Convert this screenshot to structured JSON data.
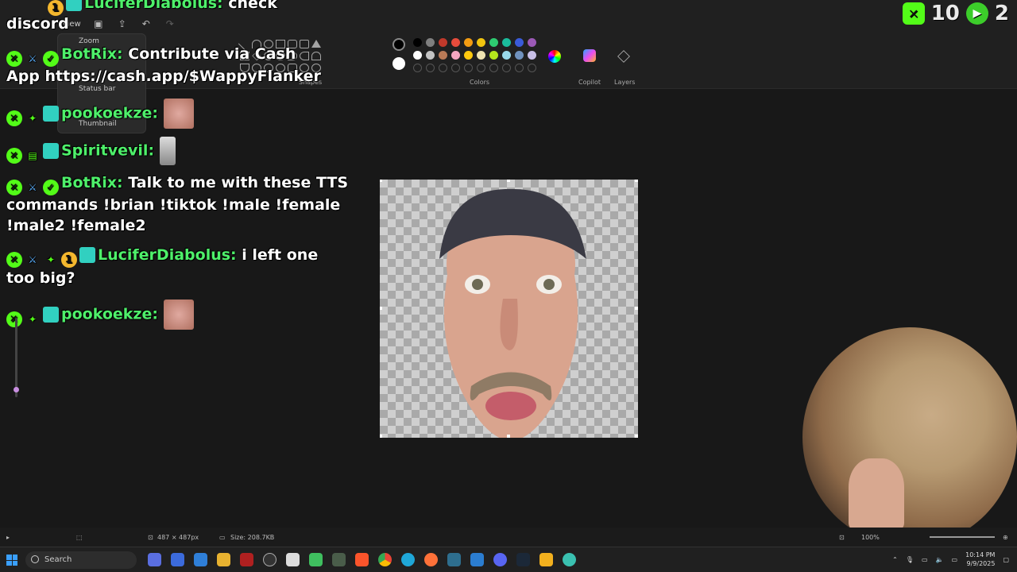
{
  "ribbon": {
    "view_menu": "View",
    "groups": [
      "Shapes",
      "Colors",
      "Copilot",
      "Layers"
    ],
    "dropdown_items": [
      "Zoom",
      "Status bar",
      "Thumbnail"
    ],
    "palette": {
      "big": [
        "#000000",
        "#ffffff"
      ],
      "row1": [
        "#000000",
        "#7f7f7f",
        "#c0392b",
        "#e74c3c",
        "#f39c12",
        "#f1c40f",
        "#2ecc71",
        "#1abc9c",
        "#3a5bd9",
        "#9b59b6"
      ],
      "row2": [
        "#ffffff",
        "#c3c3c3",
        "#b97a57",
        "#f4a6c0",
        "#ffc90e",
        "#efe4b0",
        "#b5e61d",
        "#99d9ea",
        "#7092be",
        "#c8bfe7"
      ]
    }
  },
  "chat": [
    {
      "name": "LuciferDiabolus:",
      "text": "check",
      "cont": "discord"
    },
    {
      "name": "BotRix:",
      "text": "Contribute via Cash",
      "cont": "App https://cash.app/$WappyFlanker"
    },
    {
      "name": "pookoekze:",
      "text": ""
    },
    {
      "name": "Spiritvevil:",
      "text": ""
    },
    {
      "name": "BotRix:",
      "text": "Talk to me with these TTS",
      "cont": "commands !brian !tiktok !male !female",
      "cont2": "!male2 !female2"
    },
    {
      "name": "LuciferDiabolus:",
      "text": "i left one",
      "cont": "too big?"
    },
    {
      "name": "pookoekze:",
      "text": ""
    }
  ],
  "widget": {
    "count1": "10",
    "count2": "2"
  },
  "status": {
    "dimensions": "487 × 487px",
    "size": "Size: 208.7KB",
    "zoom": "100%"
  },
  "taskbar": {
    "search": "Search",
    "time": "10:14 PM",
    "date": "9/9/2025"
  },
  "colors": {
    "accent_name": "#4ef06a",
    "kick_green": "#53fc18"
  }
}
